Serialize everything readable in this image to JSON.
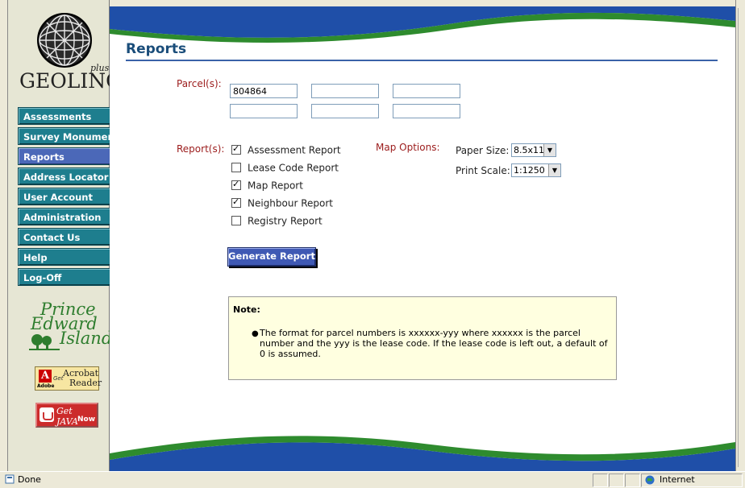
{
  "sidebar": {
    "logo": {
      "brand": "GEOLINC",
      "suffix": "plus"
    },
    "nav": [
      {
        "label": "Assessments"
      },
      {
        "label": "Survey Monuments"
      },
      {
        "label": "Reports"
      },
      {
        "label": "Address Locator"
      },
      {
        "label": "User Account"
      },
      {
        "label": "Administration"
      },
      {
        "label": "Contact Us"
      },
      {
        "label": "Help"
      },
      {
        "label": "Log-Off"
      }
    ],
    "active_nav": "Reports",
    "pei_logo": {
      "line1": "Prince",
      "line2": "Edward",
      "line3": "Island"
    },
    "acrobat": {
      "get": "Get",
      "line1": "Acrobat",
      "line2": "Reader",
      "adobe": "Adobe"
    },
    "java": {
      "get": "Get JAVA",
      "now": "Now"
    }
  },
  "main": {
    "title": "Reports",
    "parcels_label": "Parcel(s):",
    "parcels": [
      "804864",
      "",
      "",
      "",
      "",
      ""
    ],
    "reports_label": "Report(s):",
    "reports": [
      {
        "label": "Assessment Report",
        "checked": true
      },
      {
        "label": "Lease Code Report",
        "checked": false
      },
      {
        "label": "Map Report",
        "checked": true
      },
      {
        "label": "Neighbour Report",
        "checked": true
      },
      {
        "label": "Registry Report",
        "checked": false
      }
    ],
    "map_options_label": "Map Options:",
    "paper_size_label": "Paper Size:",
    "paper_size_value": "8.5x11",
    "print_scale_label": "Print Scale:",
    "print_scale_value": "1:1250",
    "generate_button": "Generate Report",
    "note": {
      "title": "Note:",
      "text": "The format for parcel numbers is xxxxxx-yyy where xxxxxx is the parcel number and the yyy is the lease code. If the lease code is left out, a default of 0 is assumed."
    }
  },
  "statusbar": {
    "text": "Done",
    "zone": "Internet"
  },
  "colors": {
    "nav_teal": "#1e7e8e",
    "nav_active": "#4b68b8",
    "title_blue": "#1a4d7a",
    "label_red": "#9b1b1b",
    "wave_blue": "#1f4fa8",
    "wave_green": "#2e8b2e",
    "note_bg": "#ffffe0"
  }
}
